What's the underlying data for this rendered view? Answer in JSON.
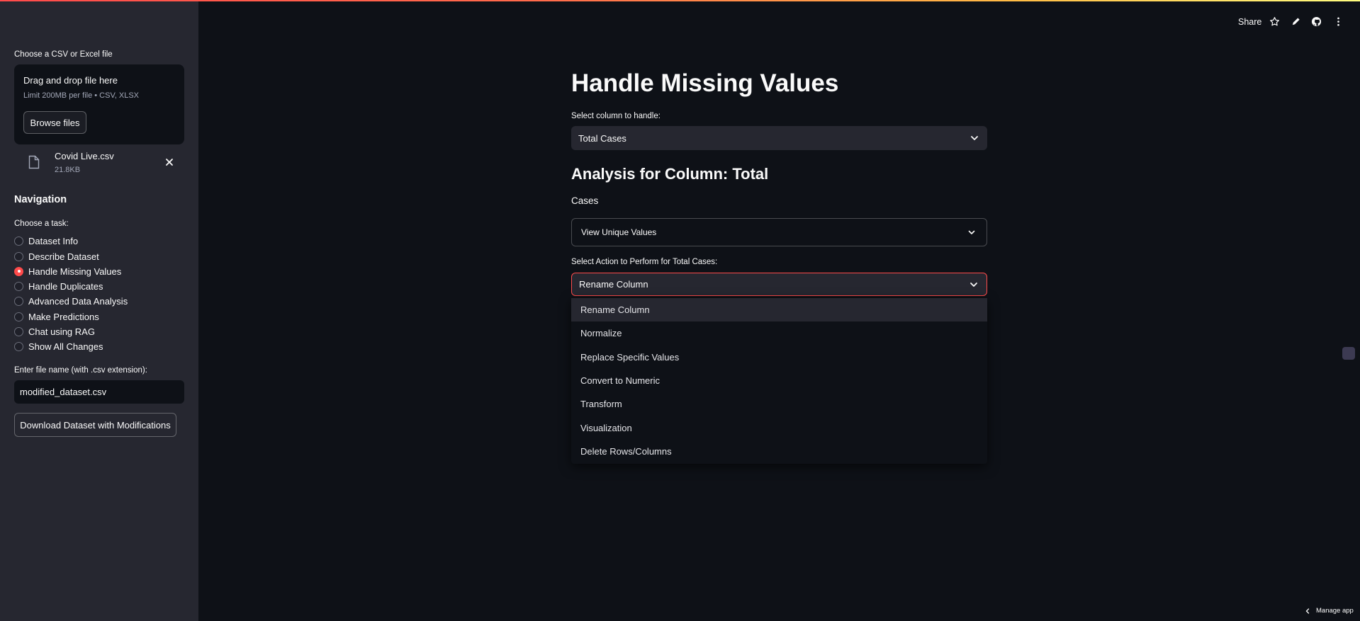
{
  "sidebar": {
    "uploader_label": "Choose a CSV or Excel file",
    "dropzone_title": "Drag and drop file here",
    "dropzone_limit": "Limit 200MB per file • CSV, XLSX",
    "browse_label": "Browse files",
    "file": {
      "name": "Covid Live.csv",
      "size": "21.8KB"
    },
    "nav_title": "Navigation",
    "task_label": "Choose a task:",
    "tasks": [
      {
        "label": "Dataset Info",
        "selected": false
      },
      {
        "label": "Describe Dataset",
        "selected": false
      },
      {
        "label": "Handle Missing Values",
        "selected": true
      },
      {
        "label": "Handle Duplicates",
        "selected": false
      },
      {
        "label": "Advanced Data Analysis",
        "selected": false
      },
      {
        "label": "Make Predictions",
        "selected": false
      },
      {
        "label": "Chat using RAG",
        "selected": false
      },
      {
        "label": "Show All Changes",
        "selected": false
      }
    ],
    "filename_label": "Enter file name (with .csv extension):",
    "filename_value": "modified_dataset.csv",
    "download_label": "Download Dataset with Modifications"
  },
  "header": {
    "share_label": "Share",
    "icons": [
      "star-icon",
      "pencil-icon",
      "github-icon",
      "more-vertical-icon"
    ]
  },
  "main": {
    "title": "Handle Missing Values",
    "column_select_label": "Select column to handle:",
    "column_select_value": "Total Cases",
    "analysis_heading": "Analysis for Column: Total",
    "analysis_heading_cont": "Cases",
    "expander_label": "View Unique Values",
    "action_label": "Select Action to Perform for Total Cases:",
    "action_value": "Rename Column",
    "action_options": [
      "Rename Column",
      "Normalize",
      "Replace Specific Values",
      "Convert to Numeric",
      "Transform",
      "Visualization",
      "Delete Rows/Columns"
    ]
  },
  "footer": {
    "manage_label": "Manage app"
  },
  "colors": {
    "accent": "#ff4b4b",
    "background": "#0e1117",
    "sidebar": "#262730"
  }
}
